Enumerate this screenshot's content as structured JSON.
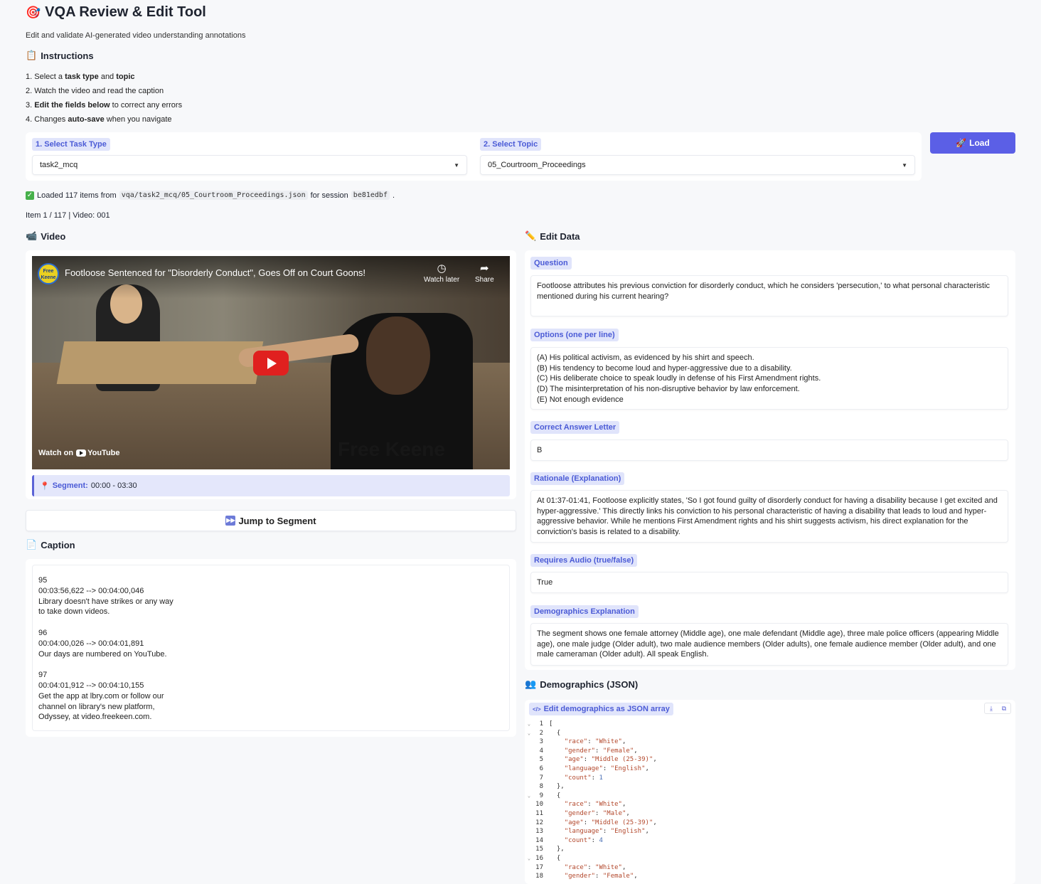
{
  "app": {
    "title_emoji": "🎯",
    "title": "VQA Review & Edit Tool",
    "subtitle": "Edit and validate AI-generated video understanding annotations"
  },
  "instructions": {
    "heading_emoji": "📋",
    "heading": "Instructions",
    "steps": [
      {
        "num": "1.",
        "pre": "Select a ",
        "b1": "task type",
        "mid": " and ",
        "b2": "topic",
        "post": ""
      },
      {
        "num": "2.",
        "pre": "Watch the video and read the caption",
        "b1": "",
        "mid": "",
        "b2": "",
        "post": ""
      },
      {
        "num": "3.",
        "pre": "",
        "b1": "Edit the fields below",
        "mid": " to correct any errors",
        "b2": "",
        "post": ""
      },
      {
        "num": "4.",
        "pre": "Changes ",
        "b1": "auto-save",
        "mid": " when you navigate",
        "b2": "",
        "post": ""
      }
    ]
  },
  "selectors": {
    "task_type_label": "1. Select Task Type",
    "task_type_value": "task2_mcq",
    "topic_label": "2. Select Topic",
    "topic_value": "05_Courtroom_Proceedings",
    "load_emoji": "🚀",
    "load_label": "Load"
  },
  "status": {
    "prefix": "Loaded 117 items from",
    "path": "vqa/task2_mcq/05_Courtroom_Proceedings.json",
    "middle": "for session",
    "session": "be81edbf",
    "suffix": ".",
    "item_info": "Item 1 / 117 | Video: 001"
  },
  "video": {
    "heading_emoji": "📹",
    "heading": "Video",
    "title": "Footloose Sentenced for \"Disorderly Conduct\", Goes Off on Court Goons!",
    "channel_logo": "Free Keene",
    "watch_later": "Watch later",
    "share": "Share",
    "watch_on": "Watch on",
    "youtube": "YouTube",
    "watermark": "Free Keene",
    "segment_label": "Segment:",
    "segment_value": "00:00 - 03:30",
    "jump_label": "Jump to Segment"
  },
  "caption": {
    "heading_emoji": "📄",
    "heading": "Caption",
    "text": "95\n00:03:56,622 --> 00:04:00,046\nLibrary doesn't have strikes or any way\nto take down videos.\n\n96\n00:04:00,026 --> 00:04:01,891\nOur days are numbered on YouTube.\n\n97\n00:04:01,912 --> 00:04:10,155\nGet the app at lbry.com or follow our\nchannel on library's new platform,\nOdyssey, at video.freekeen.com."
  },
  "edit": {
    "heading_emoji": "✏️",
    "heading": "Edit Data",
    "question_label": "Question",
    "question": "Footloose attributes his previous conviction for disorderly conduct, which he considers 'persecution,' to what personal characteristic mentioned during his current hearing?",
    "options_label": "Options (one per line)",
    "options": "(A) His political activism, as evidenced by his shirt and speech.\n(B) His tendency to become loud and hyper-aggressive due to a disability.\n(C) His deliberate choice to speak loudly in defense of his First Amendment rights.\n(D) The misinterpretation of his non-disruptive behavior by law enforcement.\n(E) Not enough evidence",
    "answer_label": "Correct Answer Letter",
    "answer": "B",
    "rationale_label": "Rationale (Explanation)",
    "rationale": "At 01:37-01:41, Footloose explicitly states, 'So I got found guilty of disorderly conduct for having a disability because I get excited and hyper-aggressive.' This directly links his conviction to his personal characteristic of having a disability that leads to loud and hyper-aggressive behavior. While he mentions First Amendment rights and his shirt suggests activism, his direct explanation for the conviction's basis is related to a disability.",
    "audio_label": "Requires Audio (true/false)",
    "audio": "True",
    "demo_expl_label": "Demographics Explanation",
    "demo_expl": "The segment shows one female attorney (Middle age), one male defendant (Middle age), three male police officers (appearing Middle age), one male judge (Older adult), two male audience members (Older adults), one female audience member (Older adult), and one male cameraman (Older adult). All speak English."
  },
  "demographics": {
    "heading_emoji": "👥",
    "heading": "Demographics (JSON)",
    "editor_label": "Edit demographics as JSON array",
    "lines": [
      {
        "n": "1",
        "fold": "⌄",
        "t": "["
      },
      {
        "n": "2",
        "fold": "⌄",
        "t": "  {"
      },
      {
        "n": "3",
        "fold": "",
        "k": "\"race\"",
        "v": "\"White\"",
        "vt": "s",
        "indent": "    "
      },
      {
        "n": "4",
        "fold": "",
        "k": "\"gender\"",
        "v": "\"Female\"",
        "vt": "s",
        "indent": "    "
      },
      {
        "n": "5",
        "fold": "",
        "k": "\"age\"",
        "v": "\"Middle (25-39)\"",
        "vt": "s",
        "indent": "    "
      },
      {
        "n": "6",
        "fold": "",
        "k": "\"language\"",
        "v": "\"English\"",
        "vt": "s",
        "indent": "    "
      },
      {
        "n": "7",
        "fold": "",
        "k": "\"count\"",
        "v": "1",
        "vt": "n",
        "indent": "    ",
        "last": true
      },
      {
        "n": "8",
        "fold": "",
        "t": "  },"
      },
      {
        "n": "9",
        "fold": "⌄",
        "t": "  {"
      },
      {
        "n": "10",
        "fold": "",
        "k": "\"race\"",
        "v": "\"White\"",
        "vt": "s",
        "indent": "    "
      },
      {
        "n": "11",
        "fold": "",
        "k": "\"gender\"",
        "v": "\"Male\"",
        "vt": "s",
        "indent": "    "
      },
      {
        "n": "12",
        "fold": "",
        "k": "\"age\"",
        "v": "\"Middle (25-39)\"",
        "vt": "s",
        "indent": "    "
      },
      {
        "n": "13",
        "fold": "",
        "k": "\"language\"",
        "v": "\"English\"",
        "vt": "s",
        "indent": "    "
      },
      {
        "n": "14",
        "fold": "",
        "k": "\"count\"",
        "v": "4",
        "vt": "n",
        "indent": "    ",
        "last": true
      },
      {
        "n": "15",
        "fold": "",
        "t": "  },"
      },
      {
        "n": "16",
        "fold": "⌄",
        "t": "  {"
      },
      {
        "n": "17",
        "fold": "",
        "k": "\"race\"",
        "v": "\"White\"",
        "vt": "s",
        "indent": "    "
      },
      {
        "n": "18",
        "fold": "",
        "k": "\"gender\"",
        "v": "\"Female\"",
        "vt": "s",
        "indent": "    "
      }
    ]
  },
  "colors": {
    "accent": "#5b5fe6",
    "label_bg": "#e0e4fb",
    "label_text": "#4b5bd6",
    "youtube_red": "#e0201f"
  }
}
